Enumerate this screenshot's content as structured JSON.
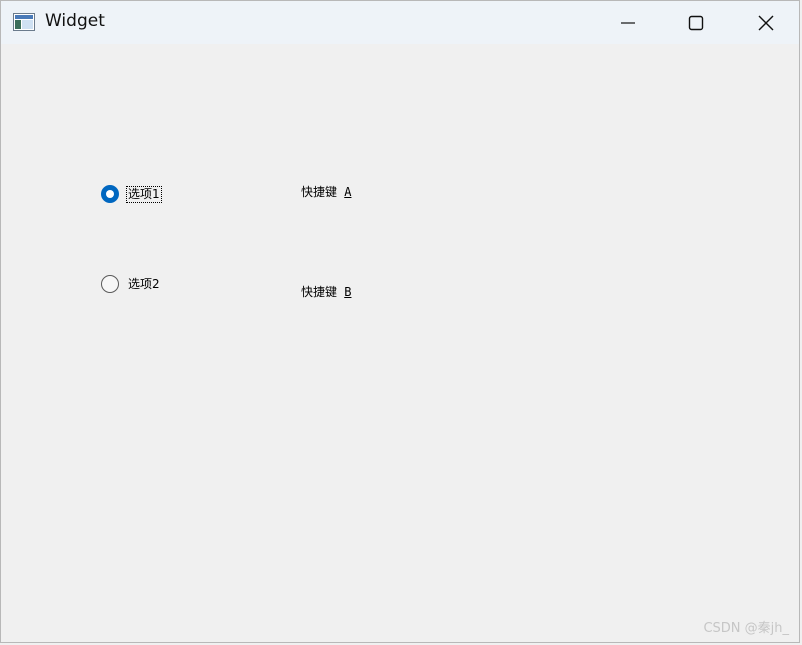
{
  "window": {
    "title": "Widget",
    "icon": "app-window-icon",
    "controls": {
      "minimize_icon": "minimize-icon",
      "maximize_icon": "maximize-icon",
      "close_icon": "close-icon"
    }
  },
  "radios": [
    {
      "label": "选项1",
      "checked": true
    },
    {
      "label": "选项2",
      "checked": false
    }
  ],
  "shortcuts": [
    {
      "prefix": "快捷键 ",
      "key": "A"
    },
    {
      "prefix": "快捷键 ",
      "key": "B"
    }
  ],
  "watermark": "CSDN @秦jh_",
  "colors": {
    "accent": "#0067c0",
    "titlebar": "#eef3f8",
    "background": "#f0f0f0"
  }
}
